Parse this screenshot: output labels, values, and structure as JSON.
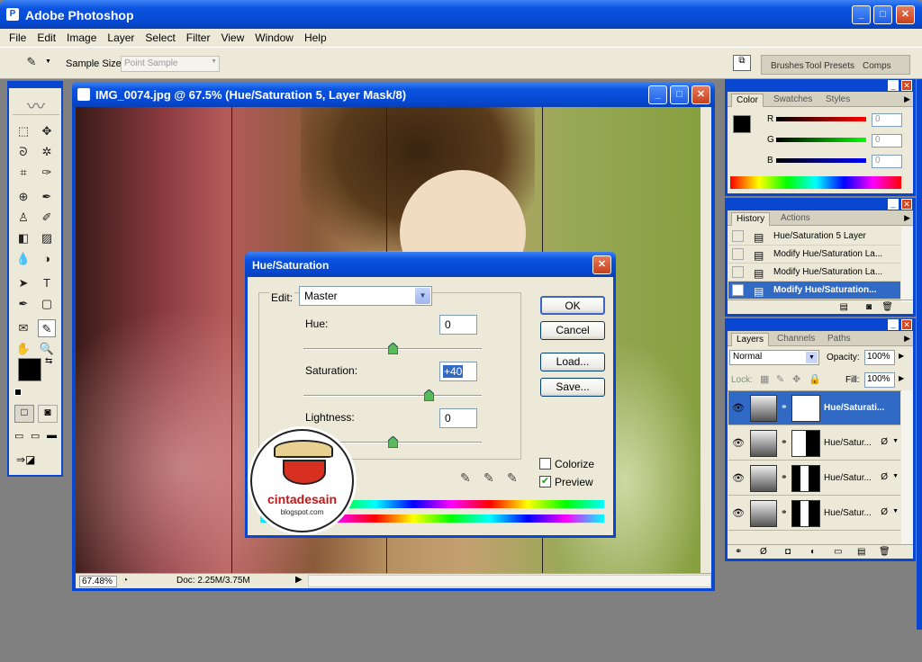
{
  "app": {
    "title": "Adobe Photoshop"
  },
  "menu": [
    "File",
    "Edit",
    "Image",
    "Layer",
    "Select",
    "Filter",
    "View",
    "Window",
    "Help"
  ],
  "options": {
    "sample_size_label": "Sample Size:",
    "sample_size_value": "Point Sample",
    "well_tabs": [
      "Brushes",
      "Tool Presets",
      "Comps"
    ]
  },
  "document": {
    "title": "IMG_0074.jpg @ 67.5% (Hue/Saturation 5, Layer Mask/8)",
    "zoom": "67.48%",
    "doc_info": "Doc: 2.25M/3.75M"
  },
  "dialog": {
    "title": "Hue/Saturation",
    "edit_label": "Edit:",
    "edit_value": "Master",
    "hue_label": "Hue:",
    "hue_value": "0",
    "hue_slider": 0,
    "sat_label": "Saturation:",
    "sat_value": "+40",
    "sat_slider": 40,
    "light_label": "Lightness:",
    "light_value": "0",
    "light_slider": 0,
    "ok": "OK",
    "cancel": "Cancel",
    "load": "Load...",
    "save": "Save...",
    "colorize": "Colorize",
    "preview": "Preview",
    "colorize_checked": false,
    "preview_checked": true
  },
  "watermark": {
    "line1": "cintadesain",
    "line2": "blogspot.com"
  },
  "color_panel": {
    "tabs": [
      "Color",
      "Swatches",
      "Styles"
    ],
    "r_label": "R",
    "g_label": "G",
    "b_label": "B",
    "r": "0",
    "g": "0",
    "b": "0"
  },
  "history_panel": {
    "tabs": [
      "History",
      "Actions"
    ],
    "items": [
      "Hue/Saturation 5 Layer",
      "Modify Hue/Saturation La...",
      "Modify Hue/Saturation La...",
      "Modify Hue/Saturation..."
    ]
  },
  "layers_panel": {
    "tabs": [
      "Layers",
      "Channels",
      "Paths"
    ],
    "blend_mode": "Normal",
    "opacity_label": "Opacity:",
    "opacity": "100%",
    "lock_label": "Lock:",
    "fill_label": "Fill:",
    "fill": "100%",
    "layers": [
      "Hue/Saturati...",
      "Hue/Satur...",
      "Hue/Satur...",
      "Hue/Satur..."
    ]
  }
}
